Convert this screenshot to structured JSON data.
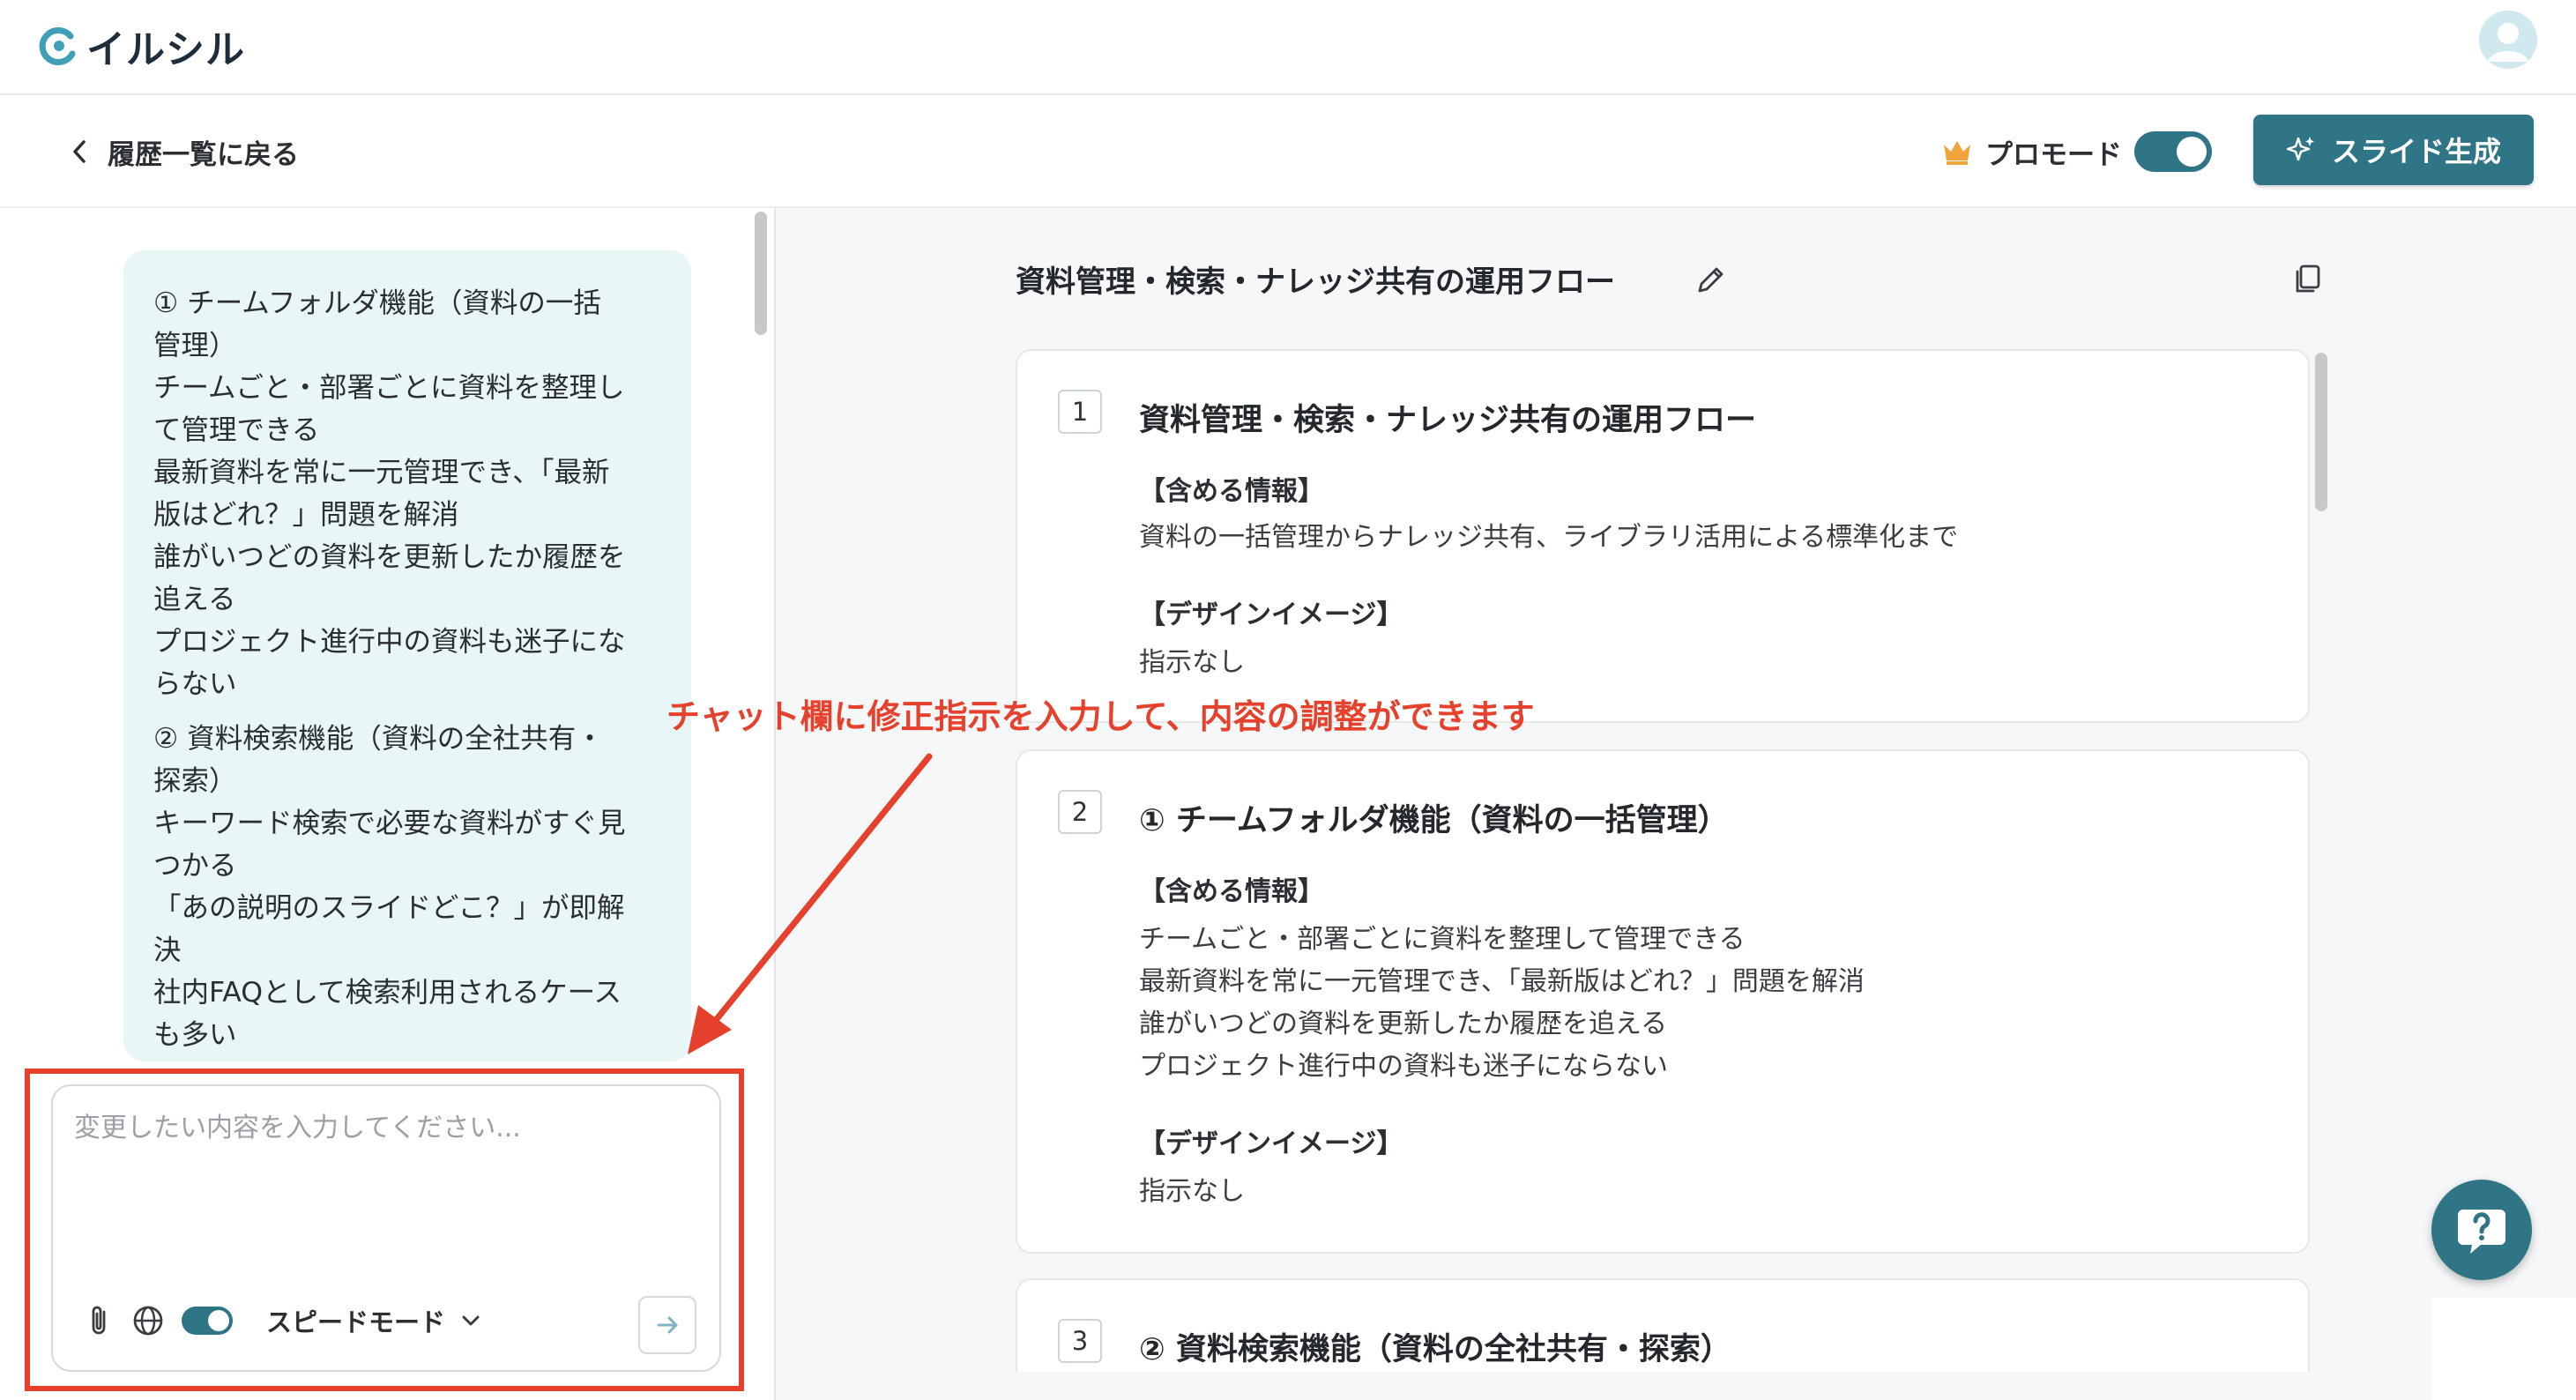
{
  "app": {
    "brand": "イルシル"
  },
  "header": {
    "back_label": "履歴一覧に戻る",
    "pro_mode_label": "プロモード",
    "pro_mode_on": true,
    "generate_button": "スライド生成"
  },
  "chat": {
    "bubble_lines": [
      [
        "① チームフォルダ機能（資料の一括",
        "管理）",
        "チームごと・部署ごとに資料を整理し",
        "て管理できる",
        "最新資料を常に一元管理でき、「最新",
        "版はどれ？」問題を解消",
        "誰がいつどの資料を更新したか履歴を",
        "追える",
        "プロジェクト進行中の資料も迷子にな",
        "らない"
      ],
      [
        "② 資料検索機能（資料の全社共有・",
        "探索）",
        "キーワード検索で必要な資料がすぐ見",
        "つかる",
        "「あの説明のスライドどこ？」が即解",
        "決",
        "社内FAQとして検索利用されるケース",
        "も多い"
      ]
    ],
    "input_placeholder": "変更したい内容を入力してください...",
    "input_value": "",
    "mode_label": "スピードモード",
    "web_toggle_on": true
  },
  "document": {
    "title": "資料管理・検索・ナレッジ共有の運用フロー",
    "cards": [
      {
        "number": "1",
        "title": "資料管理・検索・ナレッジ共有の運用フロー",
        "info_heading": "【含める情報】",
        "info_lines": [
          "資料の一括管理からナレッジ共有、ライブラリ活用による標準化まで"
        ],
        "design_heading": "【デザインイメージ】",
        "design_text": "指示なし"
      },
      {
        "number": "2",
        "title": "① チームフォルダ機能（資料の一括管理）",
        "info_heading": "【含める情報】",
        "info_lines": [
          "チームごと・部署ごとに資料を整理して管理できる",
          "最新資料を常に一元管理でき、「最新版はどれ？」問題を解消",
          "誰がいつどの資料を更新したか履歴を追える",
          "プロジェクト進行中の資料も迷子にならない"
        ],
        "design_heading": "【デザインイメージ】",
        "design_text": "指示なし"
      },
      {
        "number": "3",
        "title": "② 資料検索機能（資料の全社共有・探索）"
      }
    ]
  },
  "annotation": {
    "text": "チャット欄に修正指示を入力して、内容の調整ができます"
  },
  "colors": {
    "accent": "#2f7585",
    "highlight": "#e5412c",
    "bubble": "#e9f6f7"
  },
  "icons": [
    "logo-icon",
    "avatar-icon",
    "chevron-left-icon",
    "crown-icon",
    "sparkle-icon",
    "edit-icon",
    "copy-icon",
    "paperclip-icon",
    "globe-icon",
    "chevron-down-icon",
    "send-arrow-icon",
    "help-icon"
  ]
}
